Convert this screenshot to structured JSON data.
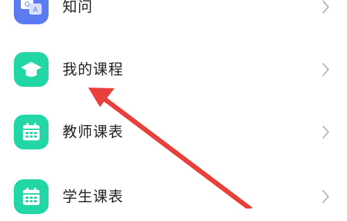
{
  "menu": {
    "items": [
      {
        "label": "知问",
        "icon": "qa-icon",
        "icon_color": "#5B7BF0"
      },
      {
        "label": "我的课程",
        "icon": "graduation-cap-icon",
        "icon_color": "#22D6A6"
      },
      {
        "label": "教师课表",
        "icon": "calendar-icon",
        "icon_color": "#22D6A6"
      },
      {
        "label": "学生课表",
        "icon": "calendar-icon",
        "icon_color": "#22D6A6"
      }
    ]
  },
  "qa_icon_text": {
    "q": "Q",
    "a": "A"
  },
  "annotation": {
    "arrow_color": "#E8403A"
  }
}
